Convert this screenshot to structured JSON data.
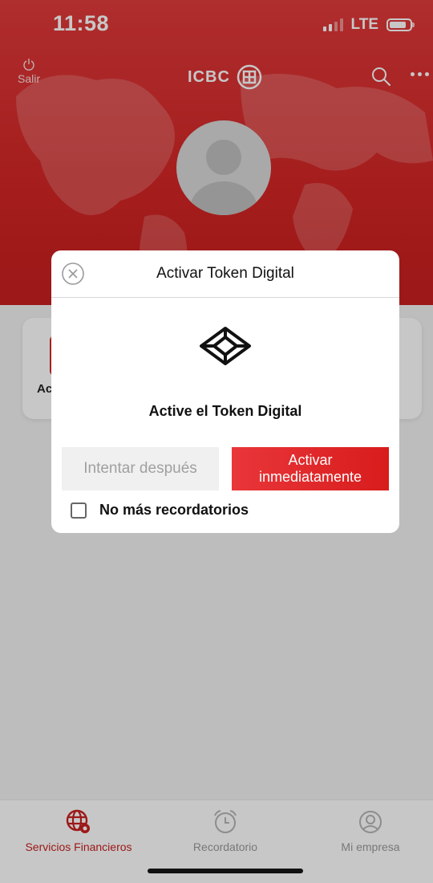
{
  "status_bar": {
    "time": "11:58",
    "network": "LTE"
  },
  "header": {
    "logout_label": "Salir",
    "brand": "ICBC",
    "brand_symbol": "工"
  },
  "card": {
    "text": "Ac"
  },
  "dialog": {
    "title": "Activar Token Digital",
    "message": "Active el Token Digital",
    "later_button": "Intentar después",
    "activate_button": "Activar inmediatamente",
    "no_reminders_label": "No más recordatorios",
    "no_reminders_checked": false
  },
  "tabbar": {
    "tabs": [
      {
        "label": "Servicios Financieros",
        "active": true,
        "icon": "globe-icon"
      },
      {
        "label": "Recordatorio",
        "active": false,
        "icon": "alarm-clock-icon"
      },
      {
        "label": "Mi empresa",
        "active": false,
        "icon": "user-circle-icon"
      }
    ]
  },
  "colors": {
    "brand_red": "#d42626",
    "active_tab": "#c8201f",
    "inactive_tab": "#9a9a9a"
  }
}
